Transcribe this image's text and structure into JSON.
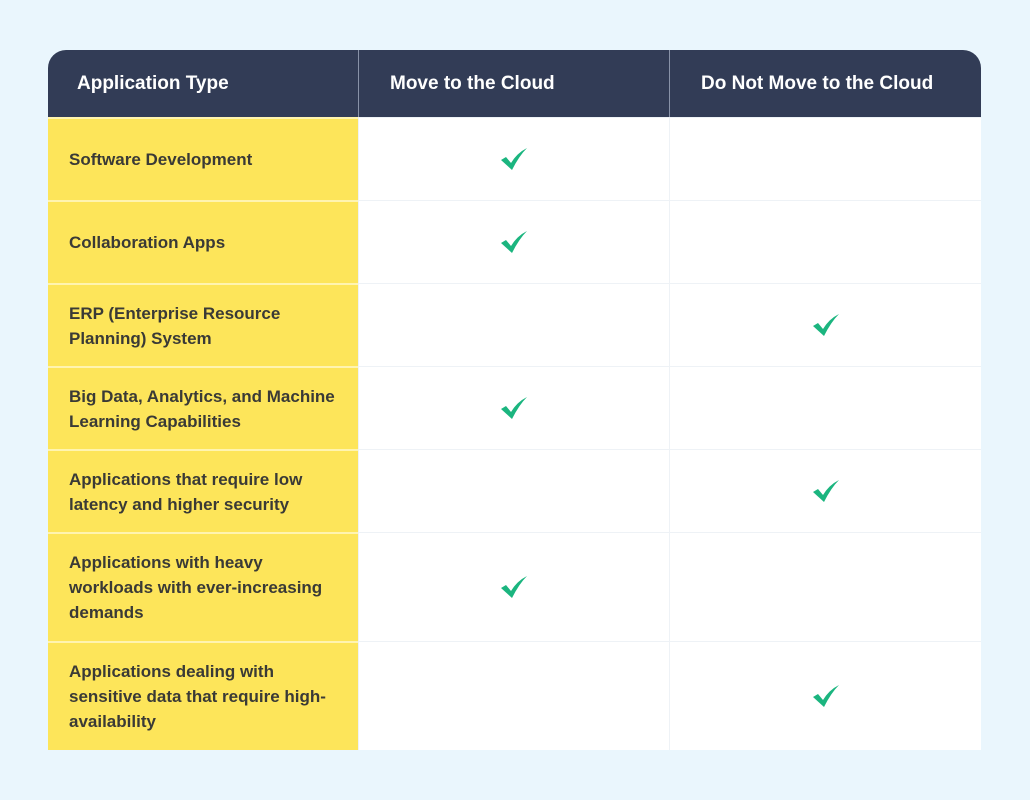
{
  "header": {
    "col1": "Application Type",
    "col2": "Move to the Cloud",
    "col3": "Do Not Move to the Cloud"
  },
  "colors": {
    "header_bg": "#323c56",
    "label_bg": "#fde55a",
    "check": "#1bb57f",
    "page_bg": "#eaf6fd"
  },
  "rows": [
    {
      "label": "Software Development",
      "move": true,
      "do_not_move": false
    },
    {
      "label": "Collaboration Apps",
      "move": true,
      "do_not_move": false
    },
    {
      "label": "ERP (Enterprise Resource Planning) System",
      "move": false,
      "do_not_move": true
    },
    {
      "label": "Big Data, Analytics, and Machine Learning Capabilities",
      "move": true,
      "do_not_move": false
    },
    {
      "label": "Applications that require low latency and higher security",
      "move": false,
      "do_not_move": true
    },
    {
      "label": "Applications with heavy workloads with ever-increasing demands",
      "move": true,
      "do_not_move": false
    },
    {
      "label": "Applications dealing with sensitive data that require high-availability",
      "move": false,
      "do_not_move": true
    }
  ]
}
